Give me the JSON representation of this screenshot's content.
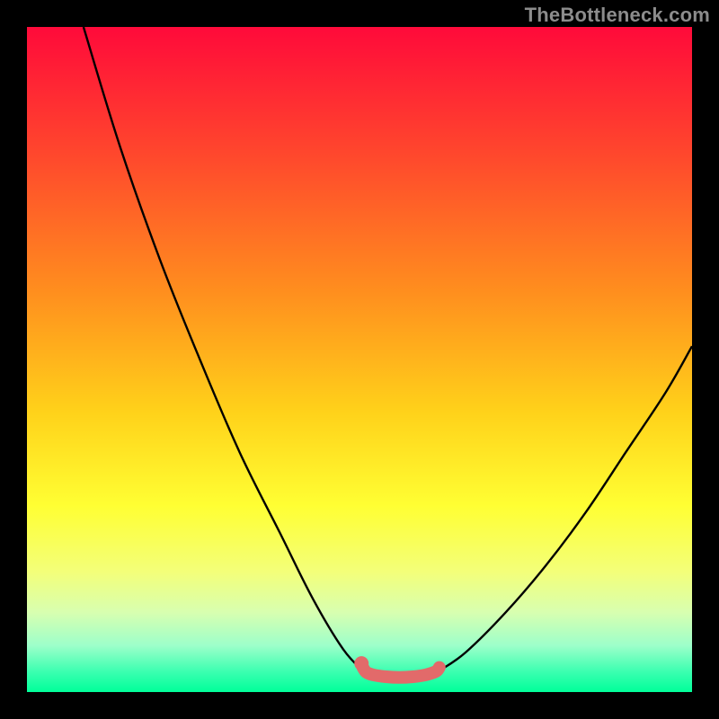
{
  "watermark": "TheBottleneck.com",
  "chart_data": {
    "type": "line",
    "title": "",
    "xlabel": "",
    "ylabel": "",
    "xlim": [
      0,
      100
    ],
    "ylim": [
      0,
      100
    ],
    "gradient_stops": [
      {
        "offset": 0,
        "color": "#ff0a3a"
      },
      {
        "offset": 20,
        "color": "#ff4a2c"
      },
      {
        "offset": 40,
        "color": "#ff8f1e"
      },
      {
        "offset": 58,
        "color": "#ffd21a"
      },
      {
        "offset": 72,
        "color": "#ffff33"
      },
      {
        "offset": 82,
        "color": "#f3ff7a"
      },
      {
        "offset": 88,
        "color": "#d8ffb0"
      },
      {
        "offset": 93,
        "color": "#9dffca"
      },
      {
        "offset": 97,
        "color": "#3affb0"
      },
      {
        "offset": 100,
        "color": "#00ff9a"
      }
    ],
    "series": [
      {
        "name": "left-curve",
        "points": [
          {
            "x": 8.5,
            "y": 100
          },
          {
            "x": 14,
            "y": 82
          },
          {
            "x": 20,
            "y": 65
          },
          {
            "x": 26,
            "y": 50
          },
          {
            "x": 32,
            "y": 36
          },
          {
            "x": 38,
            "y": 24
          },
          {
            "x": 43,
            "y": 14
          },
          {
            "x": 47.5,
            "y": 6.5
          },
          {
            "x": 50.5,
            "y": 3.2
          }
        ]
      },
      {
        "name": "right-curve",
        "points": [
          {
            "x": 62,
            "y": 3.2
          },
          {
            "x": 66,
            "y": 6
          },
          {
            "x": 72,
            "y": 12
          },
          {
            "x": 78,
            "y": 19
          },
          {
            "x": 84,
            "y": 27
          },
          {
            "x": 90,
            "y": 36
          },
          {
            "x": 96,
            "y": 45
          },
          {
            "x": 100,
            "y": 52
          }
        ]
      }
    ],
    "highlight": {
      "name": "valley-highlight",
      "color": "#e26a6a",
      "points": [
        {
          "x": 50.5,
          "y": 3.7
        },
        {
          "x": 51,
          "y": 3.0
        },
        {
          "x": 52,
          "y": 2.6
        },
        {
          "x": 54,
          "y": 2.3
        },
        {
          "x": 56,
          "y": 2.2
        },
        {
          "x": 58,
          "y": 2.3
        },
        {
          "x": 60,
          "y": 2.6
        },
        {
          "x": 61.5,
          "y": 3.1
        },
        {
          "x": 62,
          "y": 3.7
        }
      ],
      "dot": {
        "x": 50.3,
        "y": 4.3
      }
    }
  }
}
